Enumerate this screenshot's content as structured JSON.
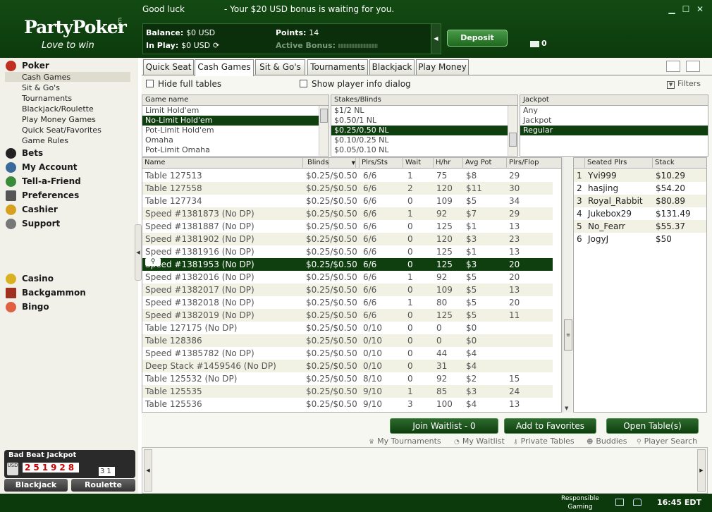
{
  "header": {
    "logo_text": "PartyPoker",
    "logo_com": ".com",
    "tagline": "Love to win",
    "greeting": "Good luck",
    "bonus_message": "- Your $20 USD bonus is waiting for you.",
    "balance_label": "Balance:",
    "balance_value": "$0 USD",
    "inplay_label": "In Play:",
    "inplay_value": "$0 USD",
    "points_label": "Points:",
    "points_value": "14",
    "active_bonus_label": "Active Bonus:",
    "deposit_label": "Deposit",
    "mail_count": "0",
    "min_icon": "▁",
    "max_icon": "☐",
    "close_icon": "✕",
    "refresh_icon": "⟳"
  },
  "sidebar": {
    "poker": "Poker",
    "poker_items": [
      "Cash Games",
      "Sit & Go's",
      "Tournaments",
      "Blackjack/Roulette",
      "Play Money Games",
      "Quick Seat/Favorites",
      "Game Rules"
    ],
    "bets": "Bets",
    "my_account": "My Account",
    "tell_a_friend": "Tell-a-Friend",
    "preferences": "Preferences",
    "cashier": "Cashier",
    "support": "Support",
    "casino": "Casino",
    "backgammon": "Backgammon",
    "bingo": "Bingo",
    "jackpot_title": "Bad Beat Jackpot",
    "jackpot_usd": "USD",
    "jackpot_digits": "251928",
    "jackpot_cents": "31",
    "blackjack_btn": "Blackjack",
    "roulette_btn": "Roulette"
  },
  "tabs": [
    "Quick Seat",
    "Cash Games",
    "Sit & Go's",
    "Tournaments",
    "Blackjack",
    "Play Money"
  ],
  "options": {
    "hide_full": "Hide full tables",
    "show_player": "Show player info dialog",
    "filters": "Filters"
  },
  "filters": {
    "game_header": "Game name",
    "games": [
      "Limit Hold'em",
      "No-Limit Hold'em",
      "Pot-Limit Hold'em",
      "Omaha",
      "Pot-Limit Omaha"
    ],
    "game_selected": 1,
    "stakes_header": "Stakes/Blinds",
    "stakes": [
      "$1/2 NL",
      "$0.50/1 NL",
      "$0.25/0.50 NL",
      "$0.10/0.25 NL",
      "$0.05/0.10 NL"
    ],
    "stakes_selected": 2,
    "jackpot_header": "Jackpot",
    "jackpot": [
      "Any",
      "Jackpot",
      "Regular"
    ],
    "jackpot_selected": 2
  },
  "table_headers": [
    "Name",
    "Blinds",
    "Plrs/Sts",
    "Wait",
    "H/hr",
    "Avg Pot",
    "Plrs/Flop"
  ],
  "tables": [
    [
      "Table  127513",
      "$0.25/$0.50",
      "6/6",
      "1",
      "75",
      "$8",
      "29"
    ],
    [
      "Table  127558",
      "$0.25/$0.50",
      "6/6",
      "2",
      "120",
      "$11",
      "30"
    ],
    [
      "Table  127734",
      "$0.25/$0.50",
      "6/6",
      "0",
      "109",
      "$5",
      "34"
    ],
    [
      "Speed #1381873 (No DP)",
      "$0.25/$0.50",
      "6/6",
      "1",
      "92",
      "$7",
      "29"
    ],
    [
      "Speed #1381887 (No DP)",
      "$0.25/$0.50",
      "6/6",
      "0",
      "125",
      "$1",
      "13"
    ],
    [
      "Speed #1381902 (No DP)",
      "$0.25/$0.50",
      "6/6",
      "0",
      "120",
      "$3",
      "23"
    ],
    [
      "Speed #1381916 (No DP)",
      "$0.25/$0.50",
      "6/6",
      "0",
      "125",
      "$1",
      "13"
    ],
    [
      "Speed #1381953 (No DP)",
      "$0.25/$0.50",
      "6/6",
      "0",
      "125",
      "$3",
      "20"
    ],
    [
      "Speed #1382016 (No DP)",
      "$0.25/$0.50",
      "6/6",
      "1",
      "92",
      "$5",
      "20"
    ],
    [
      "Speed #1382017 (No DP)",
      "$0.25/$0.50",
      "6/6",
      "0",
      "109",
      "$5",
      "13"
    ],
    [
      "Speed #1382018 (No DP)",
      "$0.25/$0.50",
      "6/6",
      "1",
      "80",
      "$5",
      "20"
    ],
    [
      "Speed #1382019 (No DP)",
      "$0.25/$0.50",
      "6/6",
      "0",
      "125",
      "$5",
      "11"
    ],
    [
      "Table  127175 (No DP)",
      "$0.25/$0.50",
      "0/10",
      "0",
      "0",
      "$0",
      ""
    ],
    [
      "Table  128386",
      "$0.25/$0.50",
      "0/10",
      "0",
      "0",
      "$0",
      ""
    ],
    [
      "Speed #1385782 (No DP)",
      "$0.25/$0.50",
      "0/10",
      "0",
      "44",
      "$4",
      ""
    ],
    [
      "Deep Stack #1459546 (No DP)",
      "$0.25/$0.50",
      "0/10",
      "0",
      "31",
      "$4",
      ""
    ],
    [
      "Table  125532 (No DP)",
      "$0.25/$0.50",
      "8/10",
      "0",
      "92",
      "$2",
      "15"
    ],
    [
      "Table  125535",
      "$0.25/$0.50",
      "9/10",
      "1",
      "85",
      "$3",
      "24"
    ],
    [
      "Table  125536",
      "$0.25/$0.50",
      "9/10",
      "3",
      "100",
      "$4",
      "13"
    ]
  ],
  "selected_table": 7,
  "seated_headers": [
    "Seated Plrs",
    "Stack"
  ],
  "seated": [
    [
      "1",
      "Yvi999",
      "$10.29"
    ],
    [
      "2",
      "hasjing",
      "$54.20"
    ],
    [
      "3",
      "Royal_Rabbit",
      "$80.89"
    ],
    [
      "4",
      "Jukebox29",
      "$131.49"
    ],
    [
      "5",
      "No_Fearr",
      "$55.37"
    ],
    [
      "6",
      "JogyJ",
      "$50"
    ]
  ],
  "actions": {
    "join_waitlist": "Join Waitlist - 0",
    "add_favorites": "Add to Favorites",
    "open_tables": "Open Table(s)"
  },
  "links": [
    "My Tournaments",
    "My Waitlist",
    "Private Tables",
    "Buddies",
    "Player Search"
  ],
  "footer": {
    "responsible_1": "Responsible",
    "responsible_2": "Gaming",
    "time": "16:45 EDT"
  }
}
